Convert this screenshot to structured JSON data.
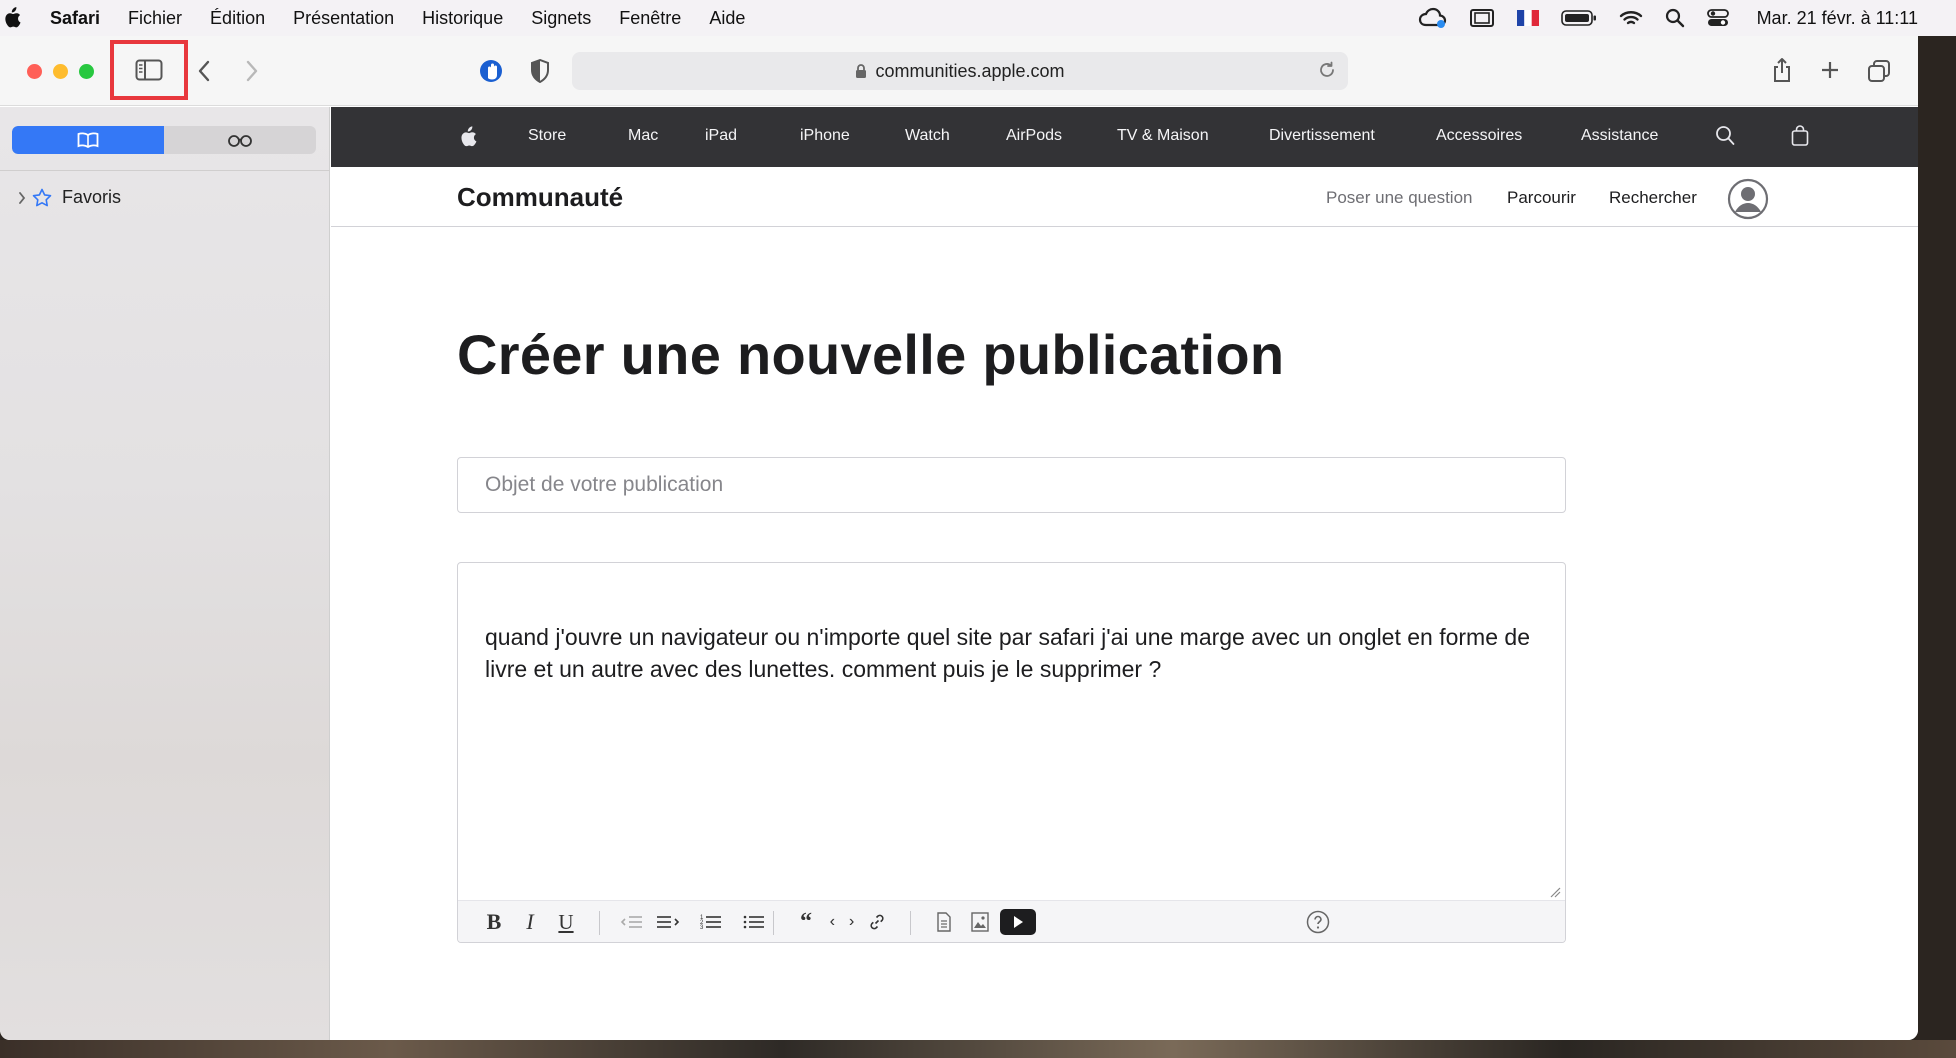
{
  "menubar": {
    "app": "Safari",
    "items": [
      "Fichier",
      "Édition",
      "Présentation",
      "Historique",
      "Signets",
      "Fenêtre",
      "Aide"
    ],
    "clock": "Mar. 21 févr. à  11:11",
    "status_icons": [
      "creative-cloud-icon",
      "screen-mirror-icon",
      "french-flag-icon",
      "battery-icon",
      "wifi-icon",
      "spotlight-icon",
      "control-center-icon"
    ]
  },
  "toolbar": {
    "url": "communities.apple.com",
    "sidebar_toggle_highlight_color": "#e8383d"
  },
  "sidebar": {
    "tabs": [
      "bookmarks-icon",
      "reading-list-icon"
    ],
    "favorites_label": "Favoris",
    "accent": "#3478f6"
  },
  "globalnav": {
    "items": [
      "Store",
      "Mac",
      "iPad",
      "iPhone",
      "Watch",
      "AirPods",
      "TV & Maison",
      "Divertissement",
      "Accessoires",
      "Assistance"
    ]
  },
  "localnav": {
    "brand": "Communauté",
    "ask": "Poser une question",
    "browse": "Parcourir",
    "search": "Rechercher"
  },
  "form": {
    "heading": "Créer une nouvelle publication",
    "subject_placeholder": "Objet de votre publication",
    "subject_value": "",
    "body_text": "quand j'ouvre un navigateur ou n'importe quel site par safari j'ai une marge avec un onglet en forme de livre et un autre avec des lunettes. comment puis je le supprimer ?",
    "editor_tools": {
      "bold": "B",
      "italic": "I",
      "underline": "U",
      "blockquote": "“",
      "code": "‹ ›"
    }
  }
}
